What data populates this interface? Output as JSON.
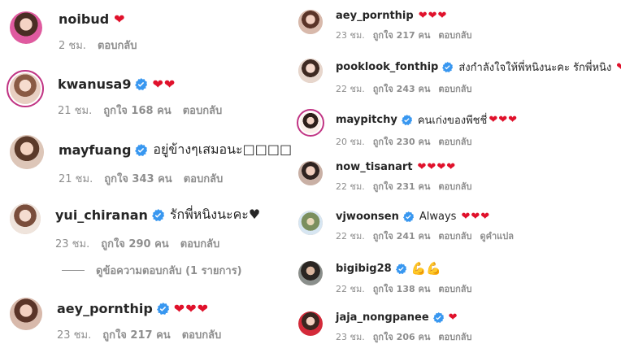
{
  "left": [
    {
      "username": "noibud",
      "verified": false,
      "text": "",
      "hearts": "❤",
      "time": "2 ชม.",
      "likes": "",
      "reply": "ตอบกลับ",
      "ring": false
    },
    {
      "username": "kwanusa9",
      "verified": true,
      "text": "",
      "hearts": "❤❤",
      "time": "21 ชม.",
      "likes": "ถูกใจ 168 คน",
      "reply": "ตอบกลับ",
      "ring": true
    },
    {
      "username": "mayfuang",
      "verified": true,
      "text": "อยู่ข้างๆเสมอนะ□□□□",
      "hearts": "",
      "time": "21 ชม.",
      "likes": "ถูกใจ 343 คน",
      "reply": "ตอบกลับ",
      "ring": false
    },
    {
      "username": "yui_chiranan",
      "verified": true,
      "text": "รักพี่หนิงนะคะ♥",
      "hearts": "",
      "time": "23 ชม.",
      "likes": "ถูกใจ 290 คน",
      "reply": "ตอบกลับ",
      "ring": false
    },
    {
      "username": "aey_pornthip",
      "verified": true,
      "text": "",
      "hearts": "❤❤❤",
      "time": "23 ชม.",
      "likes": "ถูกใจ 217 คน",
      "reply": "ตอบกลับ",
      "ring": false
    }
  ],
  "view_replies": "ดูข้อความตอบกลับ (1 รายการ)",
  "right": [
    {
      "username": "aey_pornthip",
      "verified": false,
      "text": "",
      "hearts": "❤❤❤",
      "time": "23 ชม.",
      "likes": "ถูกใจ 217 คน",
      "reply": "ตอบกลับ",
      "translate": "",
      "ring": false
    },
    {
      "username": "pooklook_fonthip",
      "verified": true,
      "text": "ส่งกำลังใจให้พี่หนิงนะคะ รักพี่หนิง",
      "hearts": "❤❤",
      "time": "22 ชม.",
      "likes": "ถูกใจ 243 คน",
      "reply": "ตอบกลับ",
      "translate": "",
      "ring": false
    },
    {
      "username": "maypitchy",
      "verified": true,
      "text": "คนเก่งของพีชชี่",
      "hearts": "❤❤❤",
      "time": "20 ชม.",
      "likes": "ถูกใจ 230 คน",
      "reply": "ตอบกลับ",
      "translate": "",
      "ring": true
    },
    {
      "username": "now_tisanart",
      "verified": false,
      "text": "",
      "hearts": "❤❤❤❤",
      "time": "22 ชม.",
      "likes": "ถูกใจ 231 คน",
      "reply": "ตอบกลับ",
      "translate": "",
      "ring": false
    },
    {
      "username": "vjwoonsen",
      "verified": true,
      "text": "Always",
      "hearts": "❤❤❤",
      "time": "22 ชม.",
      "likes": "ถูกใจ 241 คน",
      "reply": "ตอบกลับ",
      "translate": "ดูคำแปล",
      "ring": false
    },
    {
      "username": "bigibig28",
      "verified": true,
      "text": "",
      "hearts": "",
      "emoji": "💪💪",
      "time": "22 ชม.",
      "likes": "ถูกใจ 138 คน",
      "reply": "ตอบกลับ",
      "translate": "",
      "ring": false
    },
    {
      "username": "jaja_nongpanee",
      "verified": true,
      "text": "",
      "hearts": "❤",
      "time": "23 ชม.",
      "likes": "ถูกใจ 206 คน",
      "reply": "ตอบกลับ",
      "translate": "",
      "ring": false
    }
  ],
  "colors": {
    "verified": "#3897f0",
    "heart": "#e0112b",
    "muted": "#8e8e8e",
    "ring": "#c13584"
  }
}
